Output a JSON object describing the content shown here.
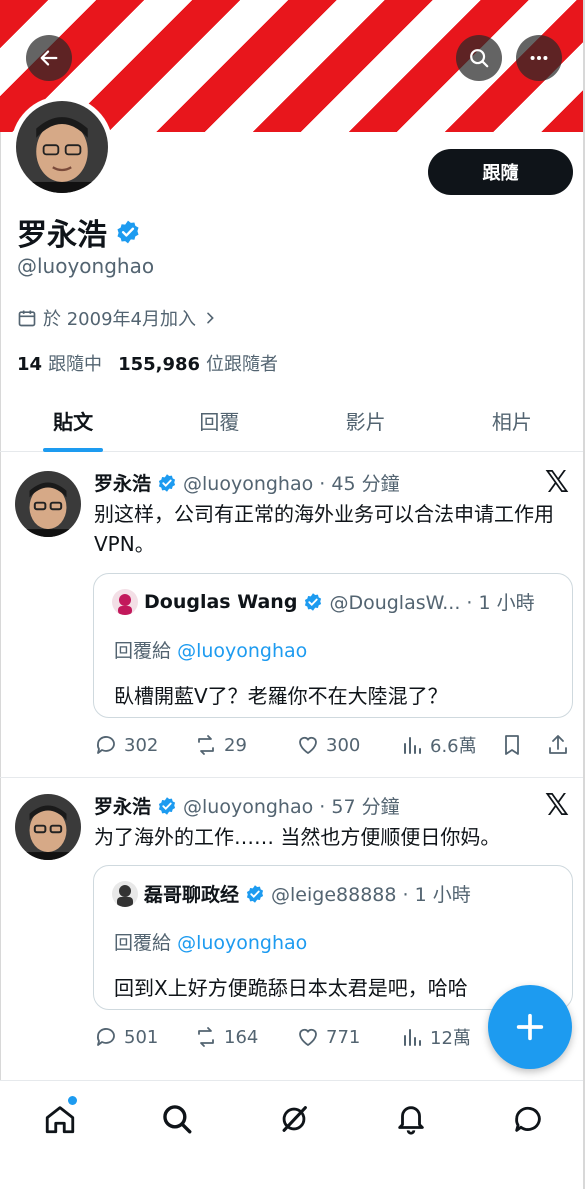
{
  "profile": {
    "name": "罗永浩",
    "handle": "@luoyonghao",
    "joined": "於 2009年4月加入",
    "following_count": "14",
    "following_label": "跟隨中",
    "followers_count": "155,986",
    "followers_label": "位跟隨者",
    "follow_button": "跟隨"
  },
  "tabs": [
    {
      "label": "貼文",
      "active": true
    },
    {
      "label": "回覆",
      "active": false
    },
    {
      "label": "影片",
      "active": false
    },
    {
      "label": "相片",
      "active": false
    }
  ],
  "posts": [
    {
      "name": "罗永浩",
      "meta": "@luoyonghao · 45 分鐘",
      "text": "别这样，公司有正常的海外业务可以合法申请工作用 VPN。",
      "quote": {
        "name": "Douglas Wang",
        "meta": "@DouglasW... · 1 小時",
        "reply_prefix": "回覆給",
        "reply_to": "@luoyonghao",
        "text": "臥槽開藍V了？老羅你不在大陸混了？"
      },
      "replies": "302",
      "reposts": "29",
      "likes": "300",
      "views": "6.6萬"
    },
    {
      "name": "罗永浩",
      "meta": "@luoyonghao · 57 分鐘",
      "text": "为了海外的工作…… 当然也方便顺便日你妈。",
      "quote": {
        "name": "磊哥聊政经",
        "meta": "@leige88888 · 1 小時",
        "reply_prefix": "回覆給",
        "reply_to": "@luoyonghao",
        "text": "回到X上好方便跪舔日本太君是吧，哈哈"
      },
      "replies": "501",
      "reposts": "164",
      "likes": "771",
      "views": "12萬"
    }
  ],
  "icons": {
    "back": "arrow-left-icon",
    "search": "search-icon",
    "more": "more-icon",
    "verified": "verified-badge-icon",
    "x": "x-logo-icon",
    "compose": "plus-icon"
  },
  "colors": {
    "accent": "#1d9bf0",
    "banner_red": "#e8161c"
  }
}
